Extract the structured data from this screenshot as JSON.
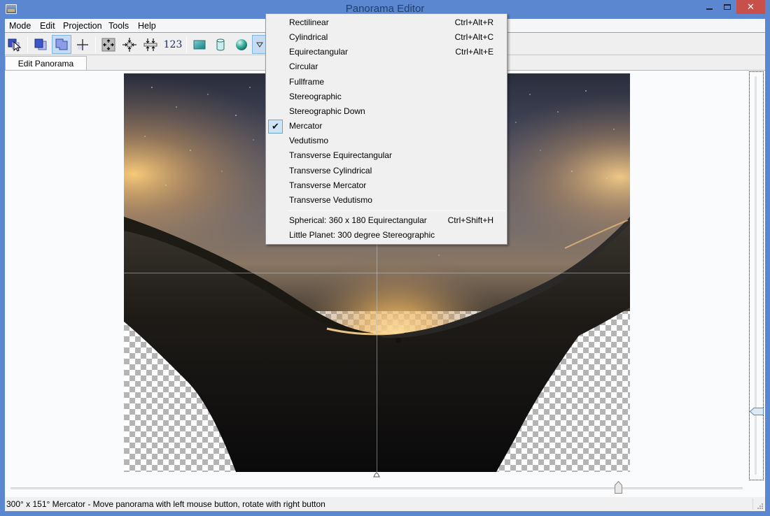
{
  "window": {
    "title": "Panorama Editor",
    "close_glyph": "✕"
  },
  "menubar": {
    "items": [
      "Mode",
      "Edit",
      "Projection",
      "Tools",
      "Help"
    ]
  },
  "toolbar": {
    "buttons": [
      {
        "name": "select-mode",
        "icon": "select-pointer-icon",
        "active": false
      },
      {
        "name": "images-preview",
        "icon": "overlapping-images-icon",
        "active": false
      },
      {
        "name": "layout-mode",
        "icon": "panorama-layout-icon",
        "active": true
      },
      {
        "name": "crosshair",
        "icon": "crosshair-icon",
        "active": false
      },
      {
        "name": "fit-panorama",
        "icon": "fit-expand-icon",
        "active": false
      },
      {
        "name": "center-panorama",
        "icon": "center-arrows-icon",
        "active": false
      },
      {
        "name": "straighten",
        "icon": "straighten-horizon-icon",
        "active": false
      },
      {
        "name": "numeric-transform",
        "icon": "numeric-123-icon",
        "label": "123",
        "active": false
      },
      {
        "name": "rectilinear-projection",
        "icon": "flat-rectangle-icon",
        "active": false
      },
      {
        "name": "cylindrical-projection",
        "icon": "cylinder-icon",
        "active": false
      },
      {
        "name": "spherical-projection",
        "icon": "sphere-icon",
        "active": false
      },
      {
        "name": "projection-dropdown",
        "icon": "dropdown-triangle-icon",
        "active": true
      }
    ]
  },
  "tabs": [
    {
      "label": "Edit Panorama",
      "selected": true
    }
  ],
  "projection_menu": {
    "items": [
      {
        "label": "Rectilinear",
        "shortcut": "Ctrl+Alt+R",
        "checked": false
      },
      {
        "label": "Cylindrical",
        "shortcut": "Ctrl+Alt+C",
        "checked": false
      },
      {
        "label": "Equirectangular",
        "shortcut": "Ctrl+Alt+E",
        "checked": false
      },
      {
        "label": "Circular",
        "shortcut": "",
        "checked": false
      },
      {
        "label": "Fullframe",
        "shortcut": "",
        "checked": false
      },
      {
        "label": "Stereographic",
        "shortcut": "",
        "checked": false
      },
      {
        "label": "Stereographic Down",
        "shortcut": "",
        "checked": false
      },
      {
        "label": "Mercator",
        "shortcut": "",
        "checked": true
      },
      {
        "label": "Vedutismo",
        "shortcut": "",
        "checked": false
      },
      {
        "label": "Transverse Equirectangular",
        "shortcut": "",
        "checked": false
      },
      {
        "label": "Transverse Cylindrical",
        "shortcut": "",
        "checked": false
      },
      {
        "label": "Transverse Mercator",
        "shortcut": "",
        "checked": false
      },
      {
        "label": "Transverse Vedutismo",
        "shortcut": "",
        "checked": false
      }
    ],
    "presets": [
      {
        "label": "Spherical: 360 x 180 Equirectangular",
        "shortcut": "Ctrl+Shift+H"
      },
      {
        "label": "Little Planet: 300 degree Stereographic",
        "shortcut": ""
      }
    ],
    "check_glyph": "✔"
  },
  "sliders": {
    "horizontal_position": 0.83,
    "vertical_position": 0.84
  },
  "statusbar": {
    "text": "300° x 151° Mercator - Move panorama with left mouse button, rotate with right button"
  }
}
